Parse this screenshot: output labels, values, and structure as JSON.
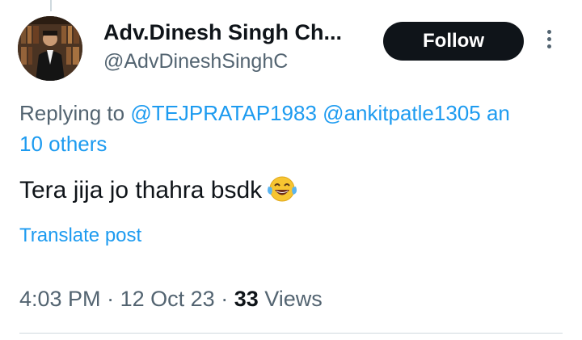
{
  "author": {
    "display_name": "Adv.Dinesh Singh Ch...",
    "handle": "@AdvDineshSinghC"
  },
  "follow_label": "Follow",
  "reply_context": {
    "prefix": "Replying to ",
    "mention_1": "@TEJPRATAP1983",
    "mention_2": "@ankitpatle1305",
    "suffix_1": "an",
    "suffix_2": "10 others"
  },
  "tweet": {
    "text": "Tera jija jo thahra bsdk",
    "emoji": "face-with-tears-of-joy"
  },
  "translate_label": "Translate post",
  "meta": {
    "time": "4:03 PM",
    "separator": "·",
    "date": "12 Oct 23",
    "views_count": "33",
    "views_label": "Views"
  },
  "colors": {
    "link": "#1d9bf0",
    "secondary_text": "#536471",
    "primary_text": "#0f1419",
    "button_bg": "#0f1419"
  }
}
